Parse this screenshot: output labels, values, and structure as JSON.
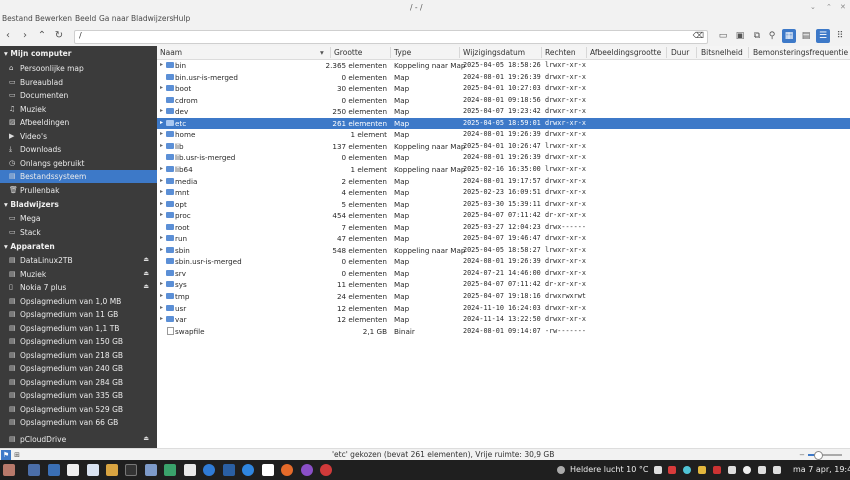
{
  "window": {
    "title": "/ - /"
  },
  "menu": [
    "Bestand",
    "Bewerken",
    "Beeld",
    "Ga naar",
    "Bladwijzers",
    "Hulp"
  ],
  "path": {
    "value": "/"
  },
  "sidebar": {
    "sections": [
      {
        "title": "Mijn computer",
        "items": [
          {
            "label": "Persoonlijke map",
            "icon": "home-icon"
          },
          {
            "label": "Bureaublad",
            "icon": "folder-icon"
          },
          {
            "label": "Documenten",
            "icon": "folder-icon"
          },
          {
            "label": "Muziek",
            "icon": "music-icon"
          },
          {
            "label": "Afbeeldingen",
            "icon": "image-icon"
          },
          {
            "label": "Video's",
            "icon": "video-icon"
          },
          {
            "label": "Downloads",
            "icon": "download-icon"
          },
          {
            "label": "Onlangs gebruikt",
            "icon": "recent-icon"
          },
          {
            "label": "Bestandssysteem",
            "icon": "drive-icon",
            "selected": true
          },
          {
            "label": "Prullenbak",
            "icon": "trash-icon"
          }
        ]
      },
      {
        "title": "Bladwijzers",
        "items": [
          {
            "label": "Mega",
            "icon": "folder-icon"
          },
          {
            "label": "Stack",
            "icon": "folder-icon"
          }
        ]
      },
      {
        "title": "Apparaten",
        "items": [
          {
            "label": "DataLinux2TB",
            "icon": "drive-icon",
            "eject": true
          },
          {
            "label": "Muziek",
            "icon": "drive-icon",
            "eject": true
          },
          {
            "label": "Nokia 7 plus",
            "icon": "phone-icon",
            "eject": true
          },
          {
            "label": "Opslagmedium van 1,0 MB",
            "icon": "drive-icon"
          },
          {
            "label": "Opslagmedium van 11 GB",
            "icon": "drive-icon"
          },
          {
            "label": "Opslagmedium van 1,1 TB",
            "icon": "drive-icon"
          },
          {
            "label": "Opslagmedium van 150 GB",
            "icon": "drive-icon"
          },
          {
            "label": "Opslagmedium van 218 GB",
            "icon": "drive-icon"
          },
          {
            "label": "Opslagmedium van 240 GB",
            "icon": "drive-icon"
          },
          {
            "label": "Opslagmedium van 284 GB",
            "icon": "drive-icon"
          },
          {
            "label": "Opslagmedium van 335 GB",
            "icon": "drive-icon"
          },
          {
            "label": "Opslagmedium van 529 GB",
            "icon": "drive-icon"
          },
          {
            "label": "Opslagmedium van 66 GB",
            "icon": "drive-icon"
          },
          {
            "label": "pCloudDrive",
            "icon": "drive-icon",
            "eject": true
          }
        ]
      }
    ]
  },
  "columns": [
    "Naam",
    "Grootte",
    "Type",
    "Wijzigingsdatum",
    "Rechten",
    "Afbeeldingsgrootte",
    "Duur",
    "Bitsnelheid",
    "Bemonsteringsfrequentie"
  ],
  "files": [
    {
      "name": "bin",
      "size": "2.365 elementen",
      "type": "Koppeling naar Map",
      "date": "2025-04-05 18:58:26",
      "perms": "lrwxr-xr-x",
      "expand": true
    },
    {
      "name": "bin.usr-is-merged",
      "size": "0 elementen",
      "type": "Map",
      "date": "2024-08-01 19:26:39",
      "perms": "drwxr-xr-x",
      "expand": false
    },
    {
      "name": "boot",
      "size": "30 elementen",
      "type": "Map",
      "date": "2025-04-01 10:27:03",
      "perms": "drwxr-xr-x",
      "expand": true
    },
    {
      "name": "cdrom",
      "size": "0 elementen",
      "type": "Map",
      "date": "2024-08-01 09:18:56",
      "perms": "drwxr-xr-x",
      "expand": false
    },
    {
      "name": "dev",
      "size": "250 elementen",
      "type": "Map",
      "date": "2025-04-07 19:23:42",
      "perms": "drwxr-xr-x",
      "expand": true
    },
    {
      "name": "etc",
      "size": "261 elementen",
      "type": "Map",
      "date": "2025-04-05 18:59:01",
      "perms": "drwxr-xr-x",
      "expand": true,
      "selected": true
    },
    {
      "name": "home",
      "size": "1 element",
      "type": "Map",
      "date": "2024-08-01 19:26:39",
      "perms": "drwxr-xr-x",
      "expand": true
    },
    {
      "name": "lib",
      "size": "137 elementen",
      "type": "Koppeling naar Map",
      "date": "2025-04-01 10:26:47",
      "perms": "lrwxr-xr-x",
      "expand": true
    },
    {
      "name": "lib.usr-is-merged",
      "size": "0 elementen",
      "type": "Map",
      "date": "2024-08-01 19:26:39",
      "perms": "drwxr-xr-x",
      "expand": false
    },
    {
      "name": "lib64",
      "size": "1 element",
      "type": "Koppeling naar Map",
      "date": "2025-02-16 16:35:00",
      "perms": "lrwxr-xr-x",
      "expand": true
    },
    {
      "name": "media",
      "size": "2 elementen",
      "type": "Map",
      "date": "2024-08-01 19:17:57",
      "perms": "drwxr-xr-x",
      "expand": true
    },
    {
      "name": "mnt",
      "size": "4 elementen",
      "type": "Map",
      "date": "2025-02-23 16:09:51",
      "perms": "drwxr-xr-x",
      "expand": true
    },
    {
      "name": "opt",
      "size": "5 elementen",
      "type": "Map",
      "date": "2025-03-30 15:39:11",
      "perms": "drwxr-xr-x",
      "expand": true
    },
    {
      "name": "proc",
      "size": "454 elementen",
      "type": "Map",
      "date": "2025-04-07 07:11:42",
      "perms": "dr-xr-xr-x",
      "expand": true
    },
    {
      "name": "root",
      "size": "7 elementen",
      "type": "Map",
      "date": "2025-03-27 12:04:23",
      "perms": "drwx------",
      "expand": false
    },
    {
      "name": "run",
      "size": "47 elementen",
      "type": "Map",
      "date": "2025-04-07 19:46:47",
      "perms": "drwxr-xr-x",
      "expand": true
    },
    {
      "name": "sbin",
      "size": "548 elementen",
      "type": "Koppeling naar Map",
      "date": "2025-04-05 18:58:27",
      "perms": "lrwxr-xr-x",
      "expand": true
    },
    {
      "name": "sbin.usr-is-merged",
      "size": "0 elementen",
      "type": "Map",
      "date": "2024-08-01 19:26:39",
      "perms": "drwxr-xr-x",
      "expand": false
    },
    {
      "name": "srv",
      "size": "0 elementen",
      "type": "Map",
      "date": "2024-07-21 14:46:00",
      "perms": "drwxr-xr-x",
      "expand": false
    },
    {
      "name": "sys",
      "size": "11 elementen",
      "type": "Map",
      "date": "2025-04-07 07:11:42",
      "perms": "dr-xr-xr-x",
      "expand": true
    },
    {
      "name": "tmp",
      "size": "24 elementen",
      "type": "Map",
      "date": "2025-04-07 19:18:16",
      "perms": "drwxrwxrwt",
      "expand": true
    },
    {
      "name": "usr",
      "size": "12 elementen",
      "type": "Map",
      "date": "2024-11-10 16:24:03",
      "perms": "drwxr-xr-x",
      "expand": true
    },
    {
      "name": "var",
      "size": "12 elementen",
      "type": "Map",
      "date": "2024-11-14 13:22:50",
      "perms": "drwxr-xr-x",
      "expand": true
    },
    {
      "name": "swapfile",
      "size": "2,1 GB",
      "type": "Binair",
      "date": "2024-08-01 09:14:07",
      "perms": "-rw-------",
      "expand": false,
      "file": true
    }
  ],
  "status": {
    "text": "'etc' gekozen (bevat 261 elementen), Vrije ruimte: 30,9 GB",
    "zoom_fraction": 0.3
  },
  "taskbar": {
    "weather": "Heldere lucht 10 °C",
    "clock": "ma 7 apr, 19:49"
  },
  "colors": {
    "accent": "#3d79c8",
    "sidebar": "#3b3b3b",
    "folder": "#5b8fd6"
  }
}
